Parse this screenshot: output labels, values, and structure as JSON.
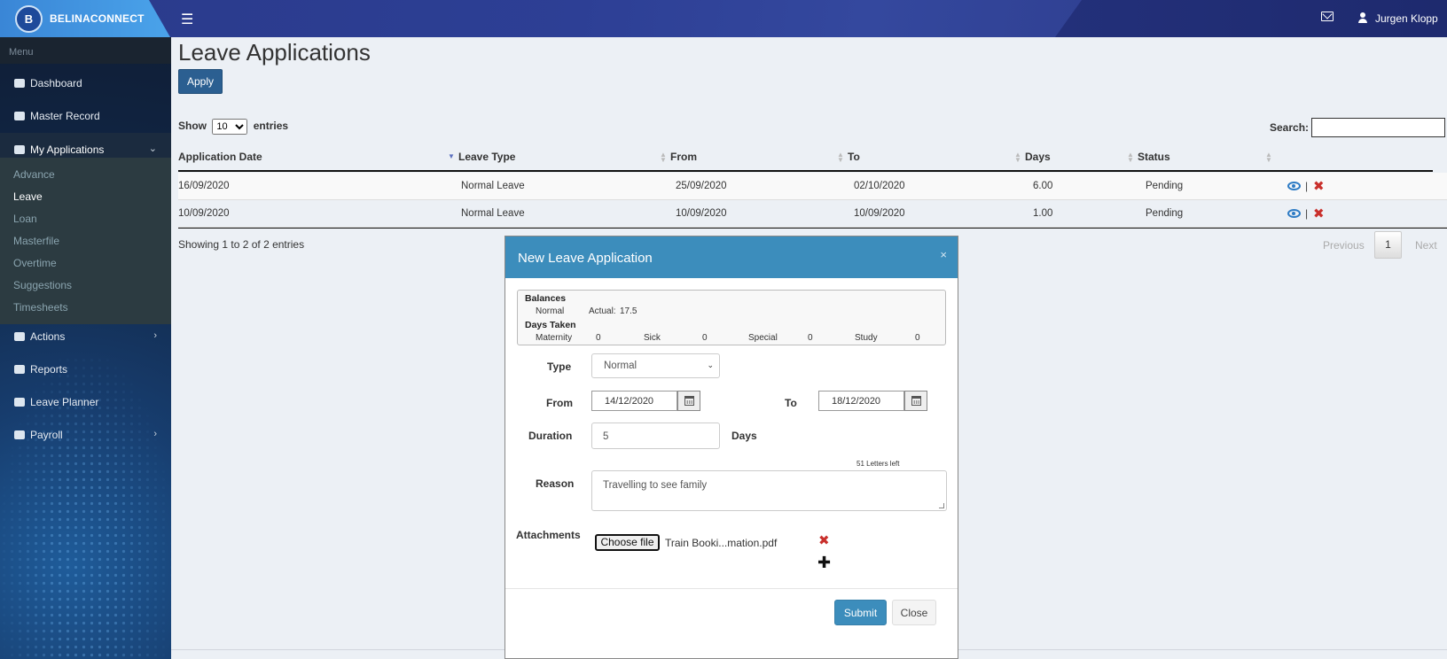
{
  "header": {
    "brand": "BELINACONNECT",
    "user_name": "Jurgen Klopp"
  },
  "sidebar": {
    "menu_header": "Menu",
    "items": [
      {
        "label": "Dashboard",
        "icon": "dashboard-icon"
      },
      {
        "label": "Master Record",
        "icon": "user-icon"
      },
      {
        "label": "My Applications",
        "icon": "envelope-icon"
      },
      {
        "label": "Actions",
        "icon": "inbox-icon"
      },
      {
        "label": "Reports",
        "icon": "book-icon"
      },
      {
        "label": "Leave Planner",
        "icon": "calendar-icon"
      },
      {
        "label": "Payroll",
        "icon": "money-icon"
      }
    ],
    "submenu": [
      "Advance",
      "Leave",
      "Loan",
      "Masterfile",
      "Overtime",
      "Suggestions",
      "Timesheets"
    ],
    "active_submenu": "Leave"
  },
  "main": {
    "title": "Leave Applications",
    "apply_label": "Apply",
    "show_label": "Show",
    "entries_label": "entries",
    "page_size": "10",
    "search_label": "Search:",
    "columns": [
      "Application Date",
      "Leave Type",
      "From",
      "To",
      "Days",
      "Status"
    ],
    "rows": [
      {
        "date": "16/09/2020",
        "type": "Normal Leave",
        "from": "25/09/2020",
        "to": "02/10/2020",
        "days": "6.00",
        "status": "Pending"
      },
      {
        "date": "10/09/2020",
        "type": "Normal Leave",
        "from": "10/09/2020",
        "to": "10/09/2020",
        "days": "1.00",
        "status": "Pending"
      }
    ],
    "action_sep": "|",
    "showing": "Showing 1 to 2 of 2 entries",
    "pagination": {
      "previous": "Previous",
      "page": "1",
      "next": "Next"
    }
  },
  "modal": {
    "title": "New Leave Application",
    "close_x": "×",
    "balances": {
      "heading": "Balances",
      "normal_label": "Normal",
      "actual_label": "Actual:",
      "actual_value": "17.5",
      "days_taken_heading": "Days Taken",
      "maternity_label": "Maternity",
      "maternity_value": "0",
      "sick_label": "Sick",
      "sick_value": "0",
      "special_label": "Special",
      "special_value": "0",
      "study_label": "Study",
      "study_value": "0"
    },
    "type_label": "Type",
    "type_value": "Normal",
    "from_label": "From",
    "from_value": "14/12/2020",
    "to_label": "To",
    "to_value": "18/12/2020",
    "duration_label": "Duration",
    "duration_value": "5",
    "days_label": "Days",
    "letters_left": "51 Letters left",
    "reason_label": "Reason",
    "reason_value": "Travelling to see family",
    "attachments_label": "Attachments",
    "choose_file_label": "Choose file",
    "file_name": "Train Booki...mation.pdf",
    "submit_label": "Submit",
    "close_label": "Close"
  }
}
